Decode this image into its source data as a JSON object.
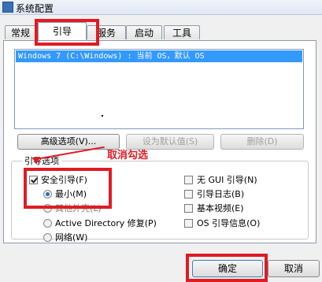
{
  "window": {
    "title": "系统配置"
  },
  "tabs": [
    "常规",
    "引导",
    "服务",
    "启动",
    "工具"
  ],
  "os_list": {
    "items": [
      "Windows 7 (C:\\Windows) : 当前 OS，默认 OS"
    ]
  },
  "buttons": {
    "advanced": "高级选项(V)...",
    "set_default": "设为默认值(S)",
    "delete": "删除(D)",
    "ok": "确定",
    "cancel": "取消"
  },
  "boot_options": {
    "label": "引导选项",
    "safe_boot": {
      "label": "安全引导(F)",
      "checked": true
    },
    "minimal": {
      "label": "最小(M)",
      "selected": true
    },
    "other_shell": {
      "label": "其他外壳(L)",
      "selected": false
    },
    "ad_repair": {
      "label": "Active Directory 修复(P)",
      "selected": false
    },
    "network": {
      "label": "网络(W)",
      "selected": false
    },
    "no_gui": {
      "label": "无 GUI 引导(N)",
      "checked": false
    },
    "boot_log": {
      "label": "引导日志(B)",
      "checked": false
    },
    "base_video": {
      "label": "基本视频(E)",
      "checked": false
    },
    "os_info": {
      "label": "OS 引导信息(O)",
      "checked": false
    }
  },
  "annotation": {
    "text": "取消勾选"
  },
  "colors": {
    "highlight": "#e01b24",
    "selection": "#3399ff"
  }
}
